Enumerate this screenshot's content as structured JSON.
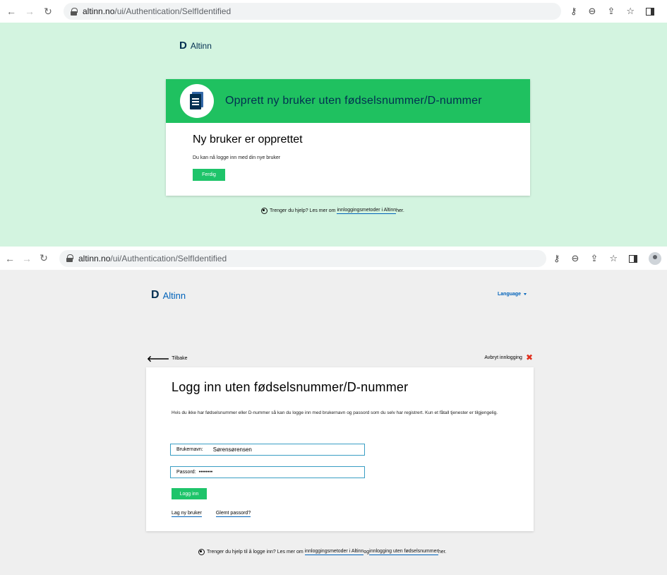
{
  "browser_top": {
    "back_icon": "arrow-left-icon",
    "forward_icon": "arrow-right-icon",
    "reload_icon": "reload-icon",
    "url_host": "altinn.no",
    "url_path": "/ui/Authentication/SelfIdentified"
  },
  "browser_bottom": {
    "url_host": "altinn.no",
    "url_path": "/ui/Authentication/SelfIdentified"
  },
  "page1": {
    "logo_text": "Altinn",
    "header_title": "Opprett ny bruker uten fødselsnummer/D-nummer",
    "heading": "Ny bruker er opprettet",
    "message": "Du kan nå logge inn med din nye bruker",
    "done_button": "Ferdig",
    "help_prefix": "Trenger du hjelp? Les mer om ",
    "help_link": "innloggingsmetoder i Altinn",
    "help_suffix": " her."
  },
  "page2": {
    "logo_text": "Altinn",
    "language_label": "Language",
    "back_label": "Tilbake",
    "cancel_label": "Avbryt innlogging",
    "heading": "Logg inn uten fødselsnummer/D-nummer",
    "intro": "Hvis du ikke har fødselsnummer eller D-nummer så kan du logge inn med brukernavn og passord som du selv har registrert. Kun et fåtall tjenester er tilgjengelig.",
    "username_label": "Brukernavn:",
    "username_value": "Sørensørensen",
    "password_label": "Passord:",
    "password_value": "••••••••",
    "login_button": "Logg inn",
    "new_user_link": "Lag ny bruker",
    "forgot_link": "Glemt passord?",
    "help_prefix": "Trenger du hjelp til å logge inn? Les mer om ",
    "help_link1": "innloggingsmetoder i Altinn",
    "help_mid": " og ",
    "help_link2": "innlogging uten fødselsnummer",
    "help_suffix": " her."
  },
  "colors": {
    "green_bg": "#d3f4e0",
    "header_green": "#1fc160",
    "button_green": "#1ec46a",
    "navy": "#022f51",
    "link_blue": "#0062ba",
    "cancel_red": "#e02e1d"
  }
}
